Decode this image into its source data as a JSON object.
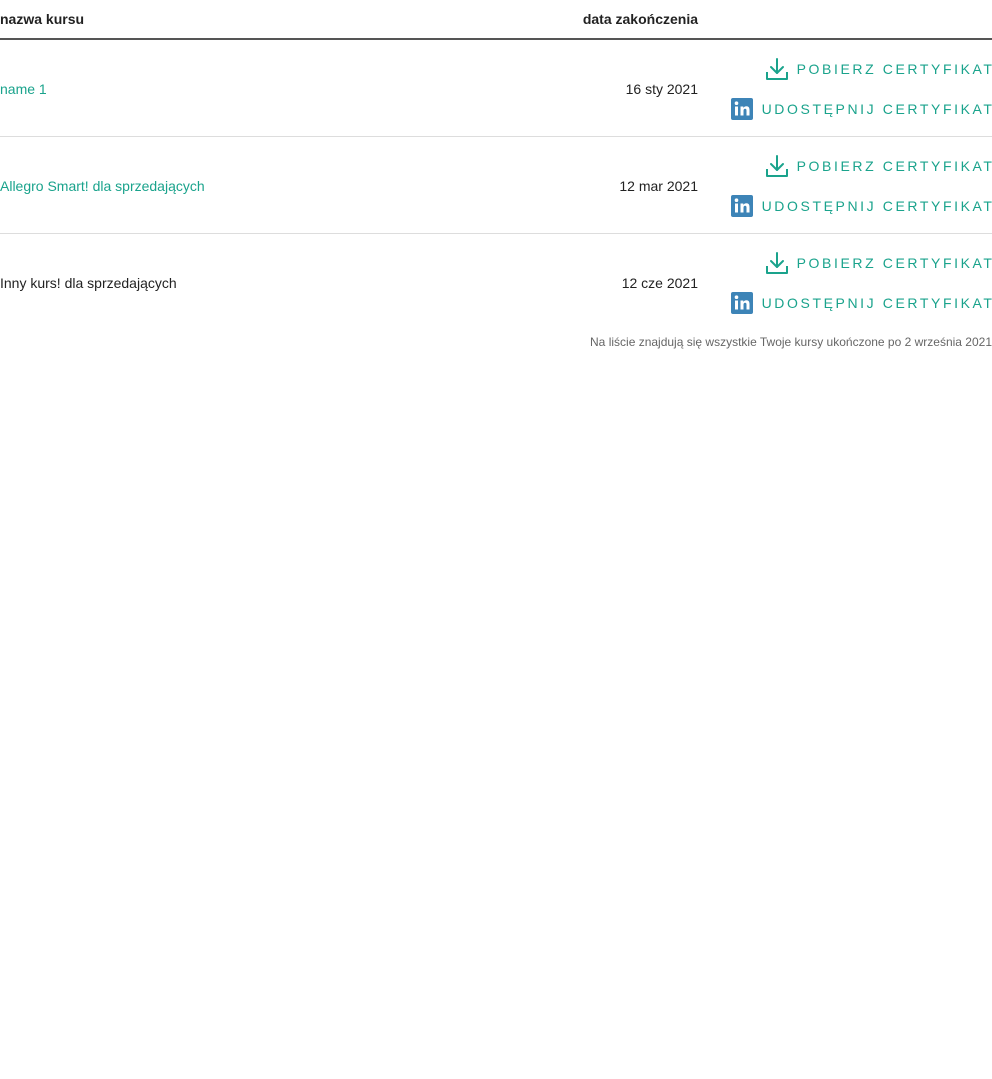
{
  "header": {
    "name_col": "nazwa kursu",
    "date_col": "data zakończenia"
  },
  "rows": [
    {
      "name": "name 1",
      "date": "16 sty 2021",
      "download_label": "POBIERZ CERTYFIKAT",
      "share_label": "UDOSTĘPNIJ CERTYFIKAT",
      "is_link": true
    },
    {
      "name": "Allegro Smart! dla sprzedających",
      "date": "12 mar 2021",
      "download_label": "POBIERZ CERTYFIKAT",
      "share_label": "UDOSTĘPNIJ CERTYFIKAT",
      "is_link": true
    },
    {
      "name": "Inny kurs! dla sprzedających",
      "date": "12 cze 2021",
      "download_label": "POBIERZ CERTYFIKAT",
      "share_label": "UDOSTĘPNIJ CERTYFIKAT",
      "is_link": false
    }
  ],
  "footnote": "Na liście znajdują się wszystkie Twoje kursy ukończone po 2 września 2021",
  "icons": {
    "download": "download-icon",
    "share": "linkedin-icon"
  },
  "colors": {
    "accent": "#1aa38c",
    "linkedin": "#3d84b7",
    "text": "#222222",
    "muted": "#666666"
  }
}
